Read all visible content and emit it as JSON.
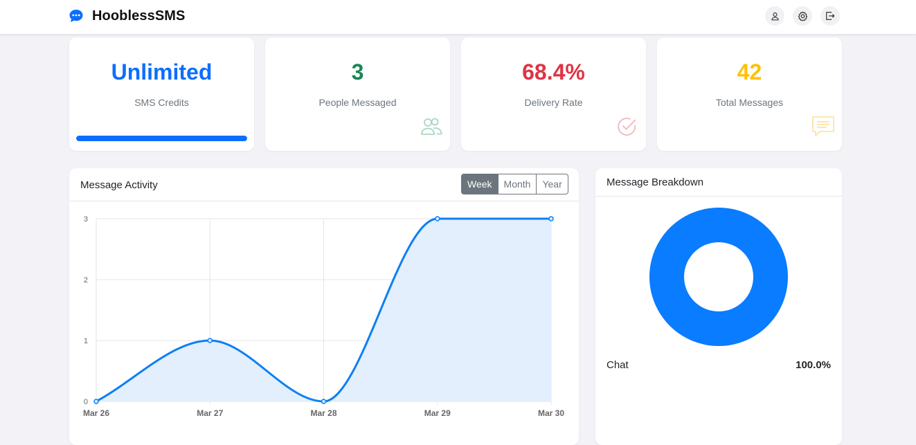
{
  "app": {
    "name": "HooblessSMS"
  },
  "nav": {
    "icons": [
      "person-icon",
      "gear-icon",
      "logout-icon"
    ]
  },
  "stats": [
    {
      "value": "Unlimited",
      "label": "SMS Credits",
      "color": "#0d6efd",
      "progress": 1.0
    },
    {
      "value": "3",
      "label": "People Messaged",
      "color": "#198754",
      "icon": "people-icon"
    },
    {
      "value": "68.4%",
      "label": "Delivery Rate",
      "color": "#dc3545",
      "icon": "check-circle-icon"
    },
    {
      "value": "42",
      "label": "Total Messages",
      "color": "#ffc107",
      "icon": "chat-lines-icon"
    }
  ],
  "activity": {
    "title": "Message Activity",
    "ranges": [
      "Week",
      "Month",
      "Year"
    ],
    "selected_range": "Week"
  },
  "breakdown": {
    "title": "Message Breakdown",
    "items": [
      {
        "label": "Chat",
        "value": "100.0%"
      }
    ]
  },
  "chart_data": [
    {
      "type": "area",
      "categories": [
        "Mar 26",
        "Mar 27",
        "Mar 28",
        "Mar 29",
        "Mar 30"
      ],
      "series": [
        {
          "values": [
            0,
            1,
            0,
            3,
            3
          ]
        }
      ],
      "ylim": [
        0,
        3
      ],
      "yticks": [
        0,
        1,
        2,
        3
      ],
      "grid": true,
      "color": "#0d7ff5",
      "fill": "#e2eefc"
    },
    {
      "type": "pie",
      "categories": [
        "Chat"
      ],
      "values": [
        100.0
      ],
      "color": "#0a7cff"
    }
  ]
}
